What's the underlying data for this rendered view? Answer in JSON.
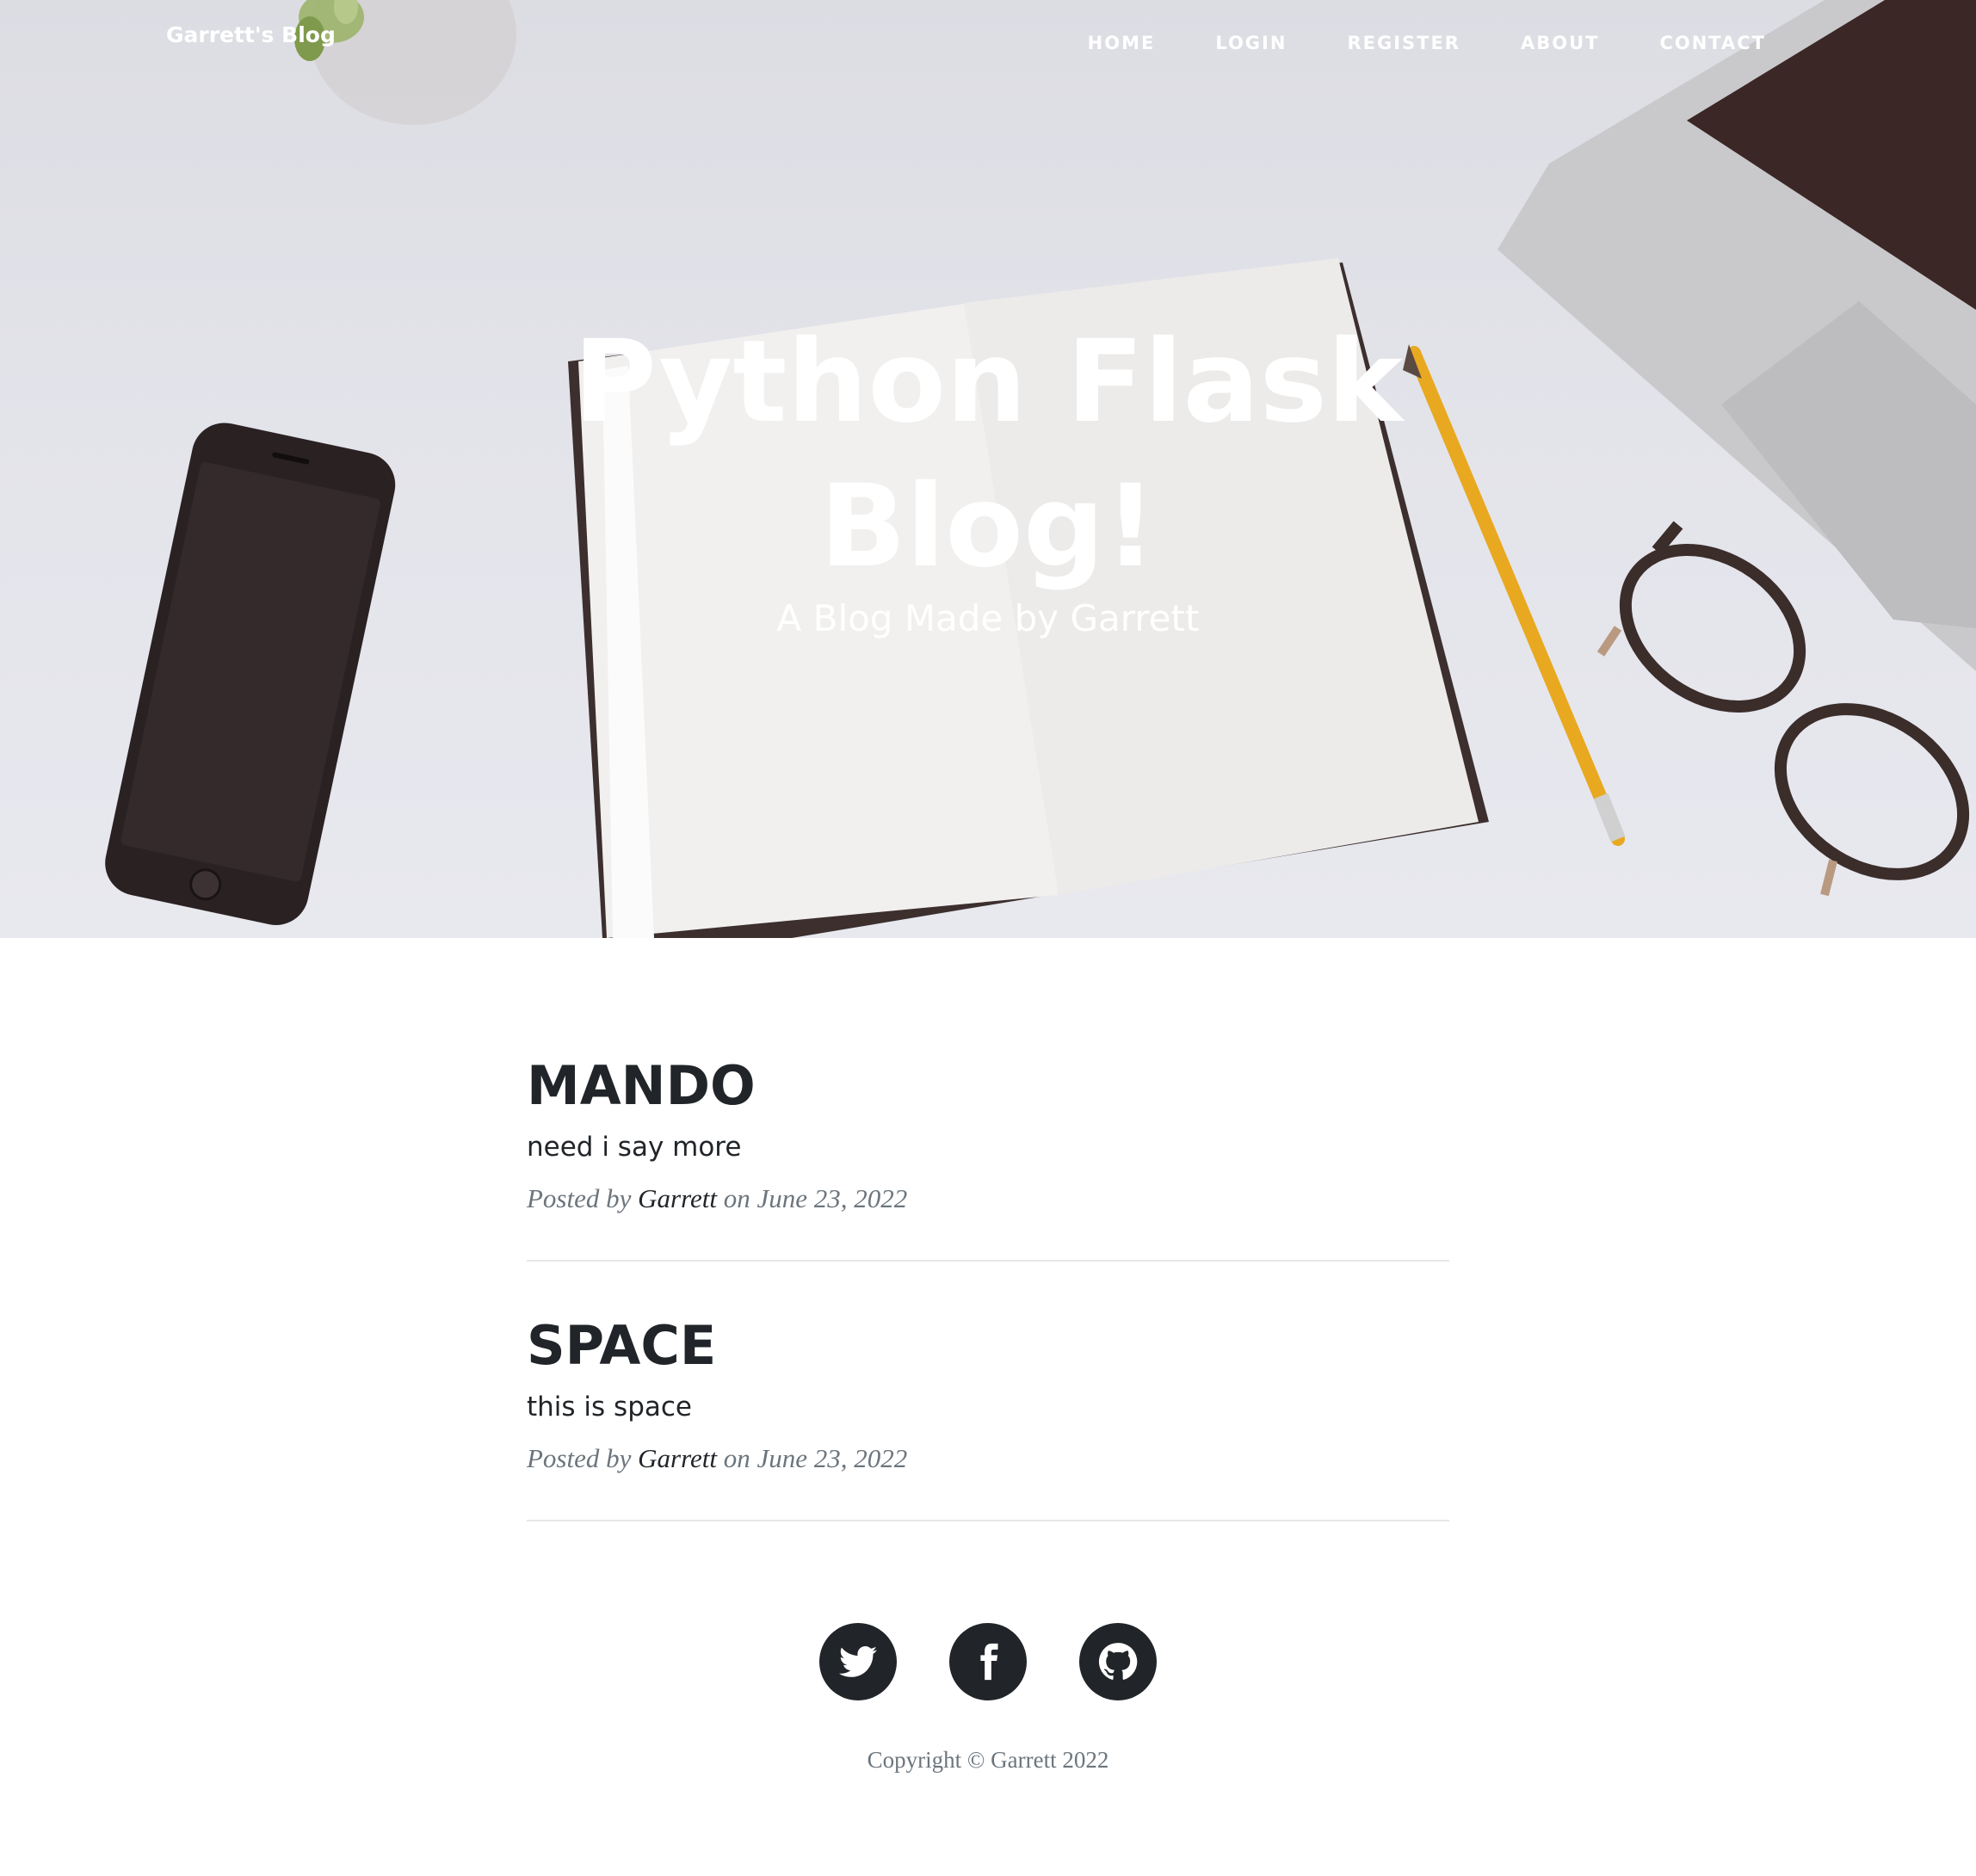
{
  "navbar": {
    "brand": "Garrett's Blog",
    "links": [
      {
        "label": "HOME"
      },
      {
        "label": "LOGIN"
      },
      {
        "label": "REGISTER"
      },
      {
        "label": "ABOUT"
      },
      {
        "label": "CONTACT"
      }
    ]
  },
  "hero": {
    "title": "Python Flask Blog!",
    "subtitle": "A Blog Made by Garrett"
  },
  "posts": [
    {
      "title": "MANDO",
      "subtitle": "need i say more",
      "meta_prefix": "Posted by ",
      "author": "Garrett",
      "meta_suffix": " on June 23, 2022"
    },
    {
      "title": "SPACE",
      "subtitle": "this is space",
      "meta_prefix": "Posted by ",
      "author": "Garrett",
      "meta_suffix": " on June 23, 2022"
    }
  ],
  "footer": {
    "social": [
      {
        "icon": "twitter-icon"
      },
      {
        "icon": "facebook-icon"
      },
      {
        "icon": "github-icon"
      }
    ],
    "copyright": "Copyright © Garrett 2022"
  },
  "colors": {
    "text_dark": "#212529",
    "text_muted": "#6c757d",
    "hero_overlay_text": "#ffffff",
    "divider": "#e6e6e6"
  }
}
